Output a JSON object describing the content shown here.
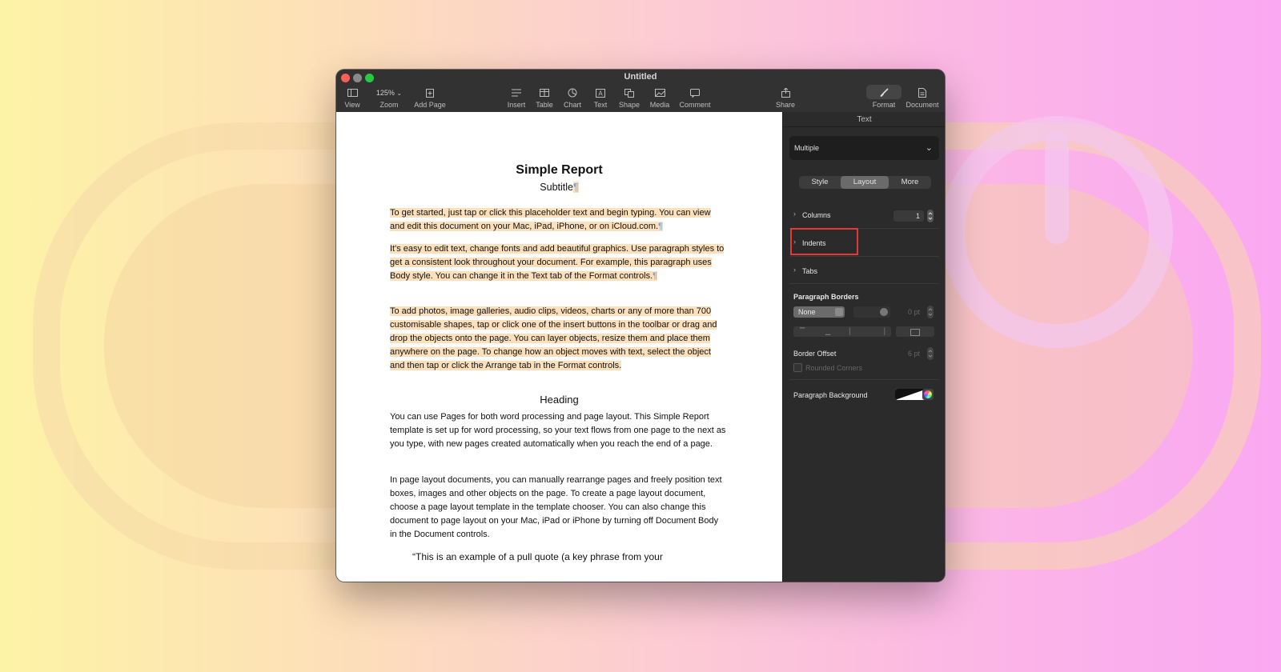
{
  "window": {
    "title": "Untitled"
  },
  "toolbar": {
    "view_label": "View",
    "zoom_value": "125%",
    "zoom_label": "Zoom",
    "add_page_label": "Add Page",
    "insert_label": "Insert",
    "table_label": "Table",
    "chart_label": "Chart",
    "text_label": "Text",
    "shape_label": "Shape",
    "media_label": "Media",
    "comment_label": "Comment",
    "share_label": "Share",
    "format_label": "Format",
    "document_label": "Document"
  },
  "document": {
    "title": "Simple Report",
    "subtitle": "Subtitle",
    "pilcrow": "¶",
    "paragraphs": [
      "To get started, just tap or click this placeholder text and begin typing. You can view and edit this document on your Mac, iPad, iPhone, or on iCloud.com.",
      "It's easy to edit text, change fonts and add beautiful graphics. Use paragraph styles to get a consistent look throughout your document. For example, this paragraph uses Body style. You can change it in the Text tab of the Format controls.",
      "To add photos, image galleries, audio clips, videos, charts or any of more than 700 customisable shapes, tap or click one of the insert buttons in the toolbar or drag and drop the objects onto the page. You can layer objects, resize them and place them anywhere on the page. To change how an object moves with text, select the object and then tap or click the Arrange tab in the Format controls."
    ],
    "heading": "Heading",
    "body_paragraphs": [
      "You can use Pages for both word processing and page layout. This Simple Report template is set up for word processing, so your text flows from one page to the next as you type, with new pages created automatically when you reach the end of a page.",
      "In page layout documents, you can manually rearrange pages and freely position text boxes, images and other objects on the page. To create a page layout document, choose a page layout template in the template chooser. You can also change this document to page layout on your Mac, iPad or iPhone by turning off Document Body in the Document controls."
    ],
    "quote": "“This is an example of a pull quote (a key phrase from your"
  },
  "panel": {
    "title": "Text",
    "paragraph_style": "Multiple",
    "tabs": [
      "Style",
      "Layout",
      "More"
    ],
    "active_tab": "Layout",
    "columns_label": "Columns",
    "columns_value": "1",
    "indents_label": "Indents",
    "tabs_label": "Tabs",
    "paragraph_borders_label": "Paragraph Borders",
    "border_style": "None",
    "border_width": "0 pt",
    "border_offset_label": "Border Offset",
    "border_offset_value": "6 pt",
    "rounded_corners_label": "Rounded Corners",
    "paragraph_background_label": "Paragraph Background"
  },
  "colors": {
    "highlight": "#fce0bc",
    "annotation_box": "#e53935",
    "panel_bg": "#2b2b2b"
  }
}
